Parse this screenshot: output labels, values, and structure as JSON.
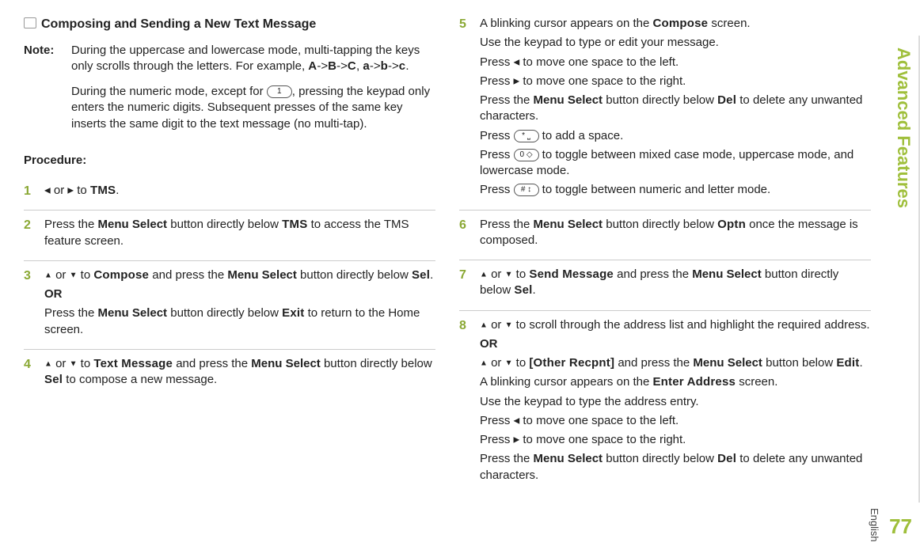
{
  "sideTab": "Advanced Features",
  "lang": "English",
  "pageNumber": "77",
  "heading": "Composing and Sending a New Text Message",
  "note": {
    "label": "Note:",
    "para1_a": "During the uppercase and lowercase mode, multi-tapping the keys only scrolls through the letters. For example, ",
    "seqA": "A",
    "arr": "->",
    "seqB": "B",
    "seqC": "C",
    "comma": ", ",
    "seqa": "a",
    "seqb": "b",
    "seqc": "c",
    "period": ".",
    "para2_a": "During the numeric mode, except for ",
    "key1": "1",
    "para2_b": ", pressing the keypad only enters the numeric digits. Subsequent presses of the same key inserts the same digit to the text message (no multi-tap)."
  },
  "procLabel": "Procedure:",
  "tri_left": "◀",
  "tri_right": "▶",
  "tri_up": "▲",
  "tri_down": "▼",
  "or": " or ",
  "to": " to ",
  "steps": {
    "s1": {
      "num": "1",
      "tms": "TMS",
      "end": "."
    },
    "s2": {
      "num": "2",
      "a": "Press the ",
      "ms": "Menu Select",
      "b": " button directly below ",
      "tms": "TMS",
      "c": " to access the TMS feature screen."
    },
    "s3": {
      "num": "3",
      "compose": "Compose",
      "a": " and press the ",
      "ms": "Menu Select",
      "b": " button directly below ",
      "sel": "Sel",
      "end": ".",
      "or": "OR",
      "c": "Press the ",
      "d": " button directly below ",
      "exit": "Exit",
      "e": " to return to the Home screen."
    },
    "s4": {
      "num": "4",
      "tm": "Text Message",
      "a": " and press the ",
      "ms": "Menu Select",
      "b": " button directly below ",
      "sel": "Sel",
      "c": " to compose a new message."
    },
    "s5": {
      "num": "5",
      "l1a": "A blinking cursor appears on the ",
      "compose": "Compose",
      "l1b": " screen.",
      "l2": "Use the keypad to type or edit your message.",
      "l3a": "Press ",
      "l3b": " to move one space to the left.",
      "l4a": "Press ",
      "l4b": " to move one space to the right.",
      "l5a": "Press the ",
      "ms": "Menu Select",
      "l5b": " button directly below ",
      "del": "Del",
      "l5c": " to delete any unwanted characters.",
      "l6a": "Press ",
      "star": "*  ⎵",
      "l6b": " to add a space.",
      "l7a": "Press ",
      "zero": "0  ◇",
      "l7b": " to toggle between mixed case mode, uppercase mode, and lowercase mode.",
      "l8a": "Press ",
      "hash": "#  ↕",
      "l8b": " to toggle between numeric and letter mode."
    },
    "s6": {
      "num": "6",
      "a": "Press the ",
      "ms": "Menu Select",
      "b": " button directly below ",
      "optn": "Optn",
      "c": " once the message is composed."
    },
    "s7": {
      "num": "7",
      "sm": "Send Message",
      "a": " and press the ",
      "ms": "Menu Select",
      "b": " button directly below ",
      "sel": "Sel",
      "end": "."
    },
    "s8": {
      "num": "8",
      "l1": " to scroll through the address list and highlight the required address.",
      "or": "OR",
      "other": "[Other Recpnt]",
      "a": " and press the ",
      "ms": "Menu Select",
      "b": " button below ",
      "edit": "Edit",
      "end": ".",
      "l3a": "A blinking cursor appears on the ",
      "ea": "Enter Address",
      "l3b": " screen.",
      "l4": "Use the keypad to type the address entry.",
      "l5a": "Press ",
      "l5b": " to move one space to the left.",
      "l6a": "Press ",
      "l6b": " to move one space to the right.",
      "l7a": "Press the ",
      "l7b": " button directly below ",
      "del": "Del",
      "l7c": " to delete any unwanted characters."
    }
  }
}
